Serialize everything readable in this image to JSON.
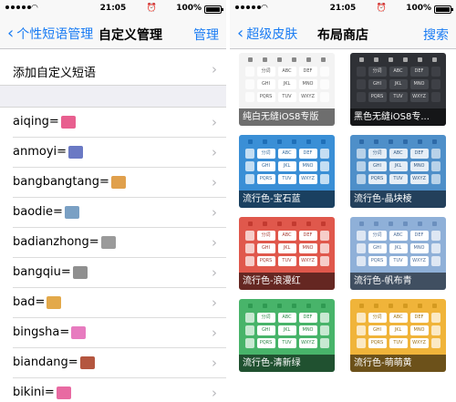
{
  "left_screen": {
    "status": {
      "time": "21:05",
      "battery": "100%"
    },
    "nav": {
      "back_label": "个性短语管理",
      "title": "自定义管理",
      "action_label": "管理"
    },
    "add_row": {
      "label": "添加自定义短语"
    },
    "phrases": [
      {
        "label": "aiqing=",
        "emoji_name": "couple-emoji",
        "emoji_color": "#e85f8f"
      },
      {
        "label": "anmoyi=",
        "emoji_name": "massage-chair-emoji",
        "emoji_color": "#6a79c4"
      },
      {
        "label": "bangbangtang=",
        "emoji_name": "lollipop-emoji",
        "emoji_color": "#e0a04c"
      },
      {
        "label": "baodie=",
        "emoji_name": "chart-down-emoji",
        "emoji_color": "#7aa0c4"
      },
      {
        "label": "badianzhong=",
        "emoji_name": "clock-emoji",
        "emoji_color": "#9a9a9a"
      },
      {
        "label": "bangqiu=",
        "emoji_name": "baseball-emoji",
        "emoji_color": "#8f8f8f"
      },
      {
        "label": "bad=",
        "emoji_name": "thumbs-down-emoji",
        "emoji_color": "#e3a94a"
      },
      {
        "label": "bingsha=",
        "emoji_name": "shaved-ice-emoji",
        "emoji_color": "#e77bbf"
      },
      {
        "label": "biandang=",
        "emoji_name": "bento-emoji",
        "emoji_color": "#b4563f"
      },
      {
        "label": "bikini=",
        "emoji_name": "bikini-emoji",
        "emoji_color": "#e86aa2"
      }
    ]
  },
  "right_screen": {
    "status": {
      "time": "21:05",
      "battery": "100%"
    },
    "nav": {
      "back_label": "超级皮肤",
      "title": "布局商店",
      "action_label": "搜索"
    },
    "skins": [
      {
        "caption": "纯白无缝iOS8专版",
        "bg": "#f3f3f3",
        "key": "#ffffff",
        "text": "#555555",
        "accent": "#888888"
      },
      {
        "caption": "黑色无缝iOS8专...",
        "bg": "#2f3136",
        "key": "#44474d",
        "text": "#dddddd",
        "accent": "#aaaaaa"
      },
      {
        "caption": "流行色-宝石蓝",
        "bg": "#3a8fd6",
        "key": "#ffffff",
        "text": "#3a6fa0",
        "accent": "#1e6fb8"
      },
      {
        "caption": "流行色-晶块棱",
        "bg": "#4e8fc9",
        "key": "#e6eef6",
        "text": "#3a5f86",
        "accent": "#2d6aa8"
      },
      {
        "caption": "流行色-浪漫红",
        "bg": "#e0584c",
        "key": "#ffffff",
        "text": "#a84038",
        "accent": "#c33a30"
      },
      {
        "caption": "流行色-帆布青",
        "bg": "#8fb0d8",
        "key": "#ffffff",
        "text": "#50709a",
        "accent": "#6b8fbe"
      },
      {
        "caption": "流行色-清新绿",
        "bg": "#48b46a",
        "key": "#ffffff",
        "text": "#2f8a4a",
        "accent": "#2f9a52"
      },
      {
        "caption": "流行色-萌萌黄",
        "bg": "#f0b43a",
        "key": "#ffffff",
        "text": "#a07418",
        "accent": "#d49a20"
      }
    ],
    "key_labels": {
      "row1": [
        "分词",
        "ABC",
        "DEF"
      ],
      "row2": [
        "GHI",
        "JKL",
        "MNO"
      ],
      "row3": [
        "PQRS",
        "TUV",
        "WXYZ"
      ]
    }
  },
  "colors": {
    "accent": "#1a7cf3",
    "separator": "#d6d6d6",
    "band": "#efeff4"
  }
}
